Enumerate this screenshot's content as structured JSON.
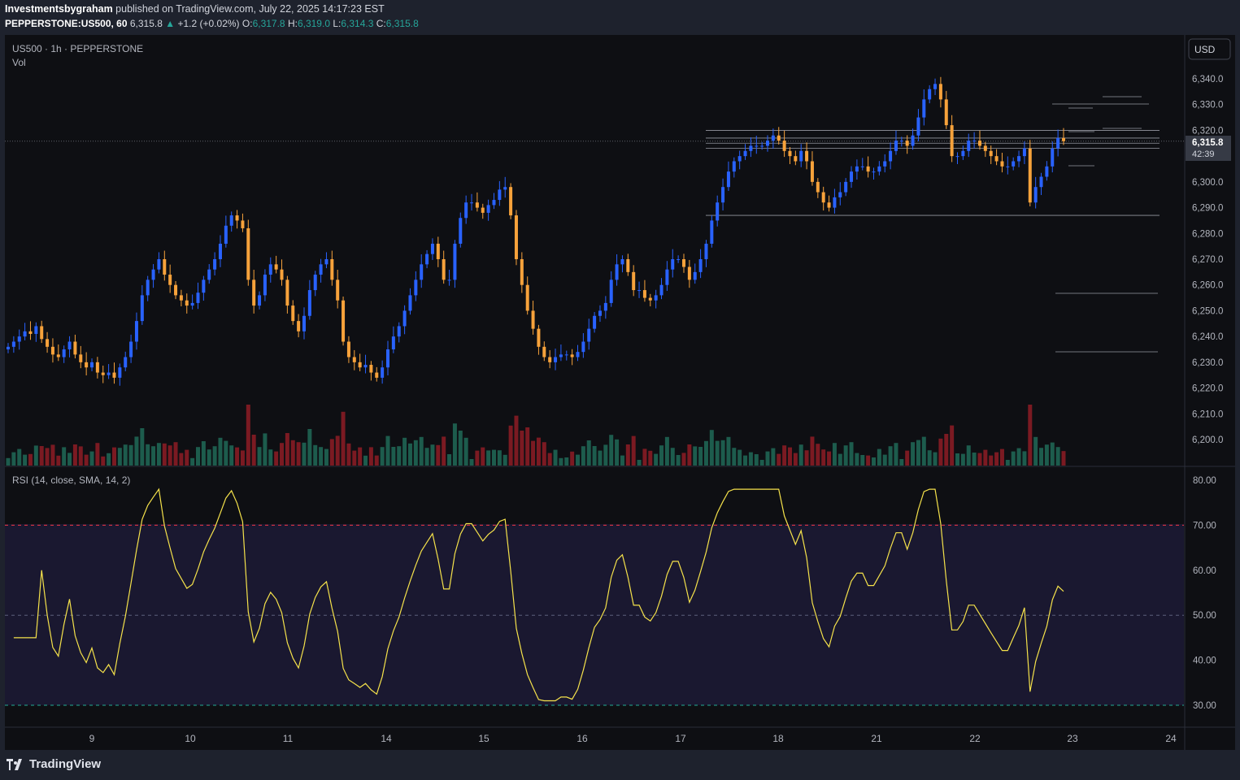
{
  "header": {
    "author": "Investmentsbygraham",
    "published": "published on TradingView.com, July 22, 2025 14:17:23 EST",
    "symbol": "PEPPERSTONE:US500, 60",
    "last": "6,315.8",
    "change": "+1.2 (+0.02%)",
    "o_label": "O:",
    "o_val": "6,317.8",
    "h_label": "H:",
    "h_val": "6,319.0",
    "l_label": "L:",
    "l_val": "6,314.3",
    "c_label": "C:",
    "c_val": "6,315.8"
  },
  "legend": {
    "title": "US500 · 1h · PEPPERSTONE",
    "vol": "Vol",
    "rsi": "RSI (14, close, SMA, 14, 2)"
  },
  "currency_button": "USD",
  "price_badge": {
    "price": "6,315.8",
    "countdown": "42:39"
  },
  "footer": {
    "brand": "TradingView"
  },
  "colors": {
    "up": "#2962ff",
    "down": "#f7a23b",
    "vol_up": "#1d5c4d",
    "vol_down": "#7b1a22",
    "rsi": "#f5e24b",
    "upper": "#f23645",
    "lower": "#22ab94"
  },
  "chart_data": [
    {
      "type": "candlestick",
      "title": "US500 · 1h · PEPPERSTONE",
      "x_ticks": [
        "9",
        "10",
        "11",
        "14",
        "15",
        "16",
        "17",
        "18",
        "21",
        "22",
        "23",
        "24"
      ],
      "y_ticks": [
        "6,340.0",
        "6,330.0",
        "6,320.0",
        "6,310.0",
        "6,300.0",
        "6,290.0",
        "6,280.0",
        "6,270.0",
        "6,260.0",
        "6,250.0",
        "6,240.0",
        "6,230.0",
        "6,220.0",
        "6,210.0",
        "6,200.0"
      ],
      "ylim": [
        6196,
        6344
      ],
      "last_price": 6315.8,
      "horizontal_levels": [
        6320,
        6317,
        6315,
        6313,
        6287
      ],
      "closes": [
        6236,
        6238,
        6240,
        6242,
        6241,
        6244,
        6239,
        6236,
        6233,
        6232,
        6235,
        6238,
        6233,
        6230,
        6228,
        6230,
        6226,
        6225,
        6226,
        6224,
        6228,
        6232,
        6238,
        6246,
        6256,
        6262,
        6266,
        6270,
        6264,
        6260,
        6256,
        6254,
        6252,
        6253,
        6257,
        6262,
        6266,
        6270,
        6276,
        6283,
        6287,
        6285,
        6282,
        6262,
        6252,
        6256,
        6264,
        6268,
        6266,
        6262,
        6252,
        6246,
        6242,
        6248,
        6258,
        6264,
        6268,
        6270,
        6262,
        6254,
        6238,
        6232,
        6230,
        6228,
        6229,
        6226,
        6224,
        6228,
        6235,
        6240,
        6244,
        6250,
        6256,
        6262,
        6268,
        6272,
        6276,
        6270,
        6262,
        6262,
        6276,
        6286,
        6292,
        6292,
        6290,
        6288,
        6291,
        6293,
        6297,
        6298,
        6287,
        6270,
        6260,
        6250,
        6243,
        6236,
        6232,
        6230,
        6232,
        6233,
        6233,
        6232,
        6234,
        6238,
        6243,
        6248,
        6250,
        6253,
        6262,
        6268,
        6270,
        6265,
        6258,
        6258,
        6255,
        6254,
        6256,
        6260,
        6266,
        6270,
        6270,
        6267,
        6262,
        6265,
        6270,
        6276,
        6285,
        6292,
        6298,
        6304,
        6308,
        6310,
        6312,
        6314,
        6314,
        6314,
        6316,
        6318,
        6316,
        6312,
        6310,
        6308,
        6312,
        6308,
        6300,
        6296,
        6292,
        6290,
        6294,
        6296,
        6300,
        6304,
        6306,
        6306,
        6304,
        6304,
        6306,
        6308,
        6312,
        6316,
        6316,
        6314,
        6318,
        6325,
        6332,
        6336,
        6338,
        6332,
        6322,
        6310,
        6310,
        6312,
        6316,
        6316,
        6314,
        6312,
        6310,
        6308,
        6306,
        6306,
        6308,
        6310,
        6313,
        6292,
        6298,
        6302,
        6306,
        6313,
        6317,
        6315.8
      ],
      "volume_max_label": "6,210.0"
    },
    {
      "type": "line",
      "title": "RSI (14, close, SMA, 14, 2)",
      "y_ticks": [
        "80.00",
        "70.00",
        "60.00",
        "50.00",
        "40.00",
        "30.00"
      ],
      "ylim": [
        27,
        82
      ],
      "upper_band": 70,
      "middle_band": 50,
      "lower_band": 30
    }
  ]
}
